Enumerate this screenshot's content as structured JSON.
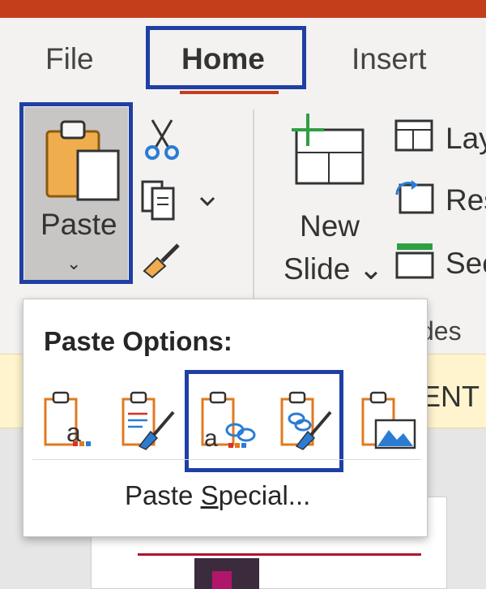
{
  "ribbon_tabs": {
    "file": "File",
    "home": "Home",
    "insert": "Insert"
  },
  "clipboard": {
    "paste_label": "Paste",
    "paste_chevron": "⌄"
  },
  "slides_group": {
    "new_slide_line1": "New",
    "new_slide_line2": "Slide ⌄",
    "layout_label": "Lay",
    "reset_label": "Res",
    "section_label": "Sec",
    "group_name_partial": "des"
  },
  "notification_bar": {
    "partial_text": "ENT"
  },
  "paste_menu": {
    "title": "Paste Options:",
    "options": [
      {
        "icon": "use-destination-theme-icon"
      },
      {
        "icon": "keep-source-formatting-icon"
      },
      {
        "icon": "use-destination-theme-link-icon"
      },
      {
        "icon": "keep-source-formatting-link-icon"
      },
      {
        "icon": "picture-icon"
      }
    ],
    "special_prefix": "Paste ",
    "special_underlined": "S",
    "special_suffix": "pecial..."
  },
  "colors": {
    "accent": "#c43e1c",
    "highlight_box": "#1f3fa3",
    "notification": "#fff4ce"
  }
}
